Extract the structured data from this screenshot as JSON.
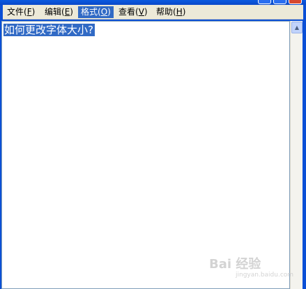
{
  "menu": {
    "file": {
      "label": "文件",
      "accel": "F"
    },
    "edit": {
      "label": "编辑",
      "accel": "E"
    },
    "format": {
      "label": "格式",
      "accel": "O"
    },
    "view": {
      "label": "查看",
      "accel": "V"
    },
    "help": {
      "label": "帮助",
      "accel": "H"
    }
  },
  "editor": {
    "selected_text": "如何更改字体大小?"
  },
  "watermark": {
    "text": "Bai 经验",
    "sub": "jingyan.baidu.com"
  },
  "colors": {
    "titlebar": "#0a4fd6",
    "selection": "#316ac5",
    "menubar": "#ece9d8"
  }
}
